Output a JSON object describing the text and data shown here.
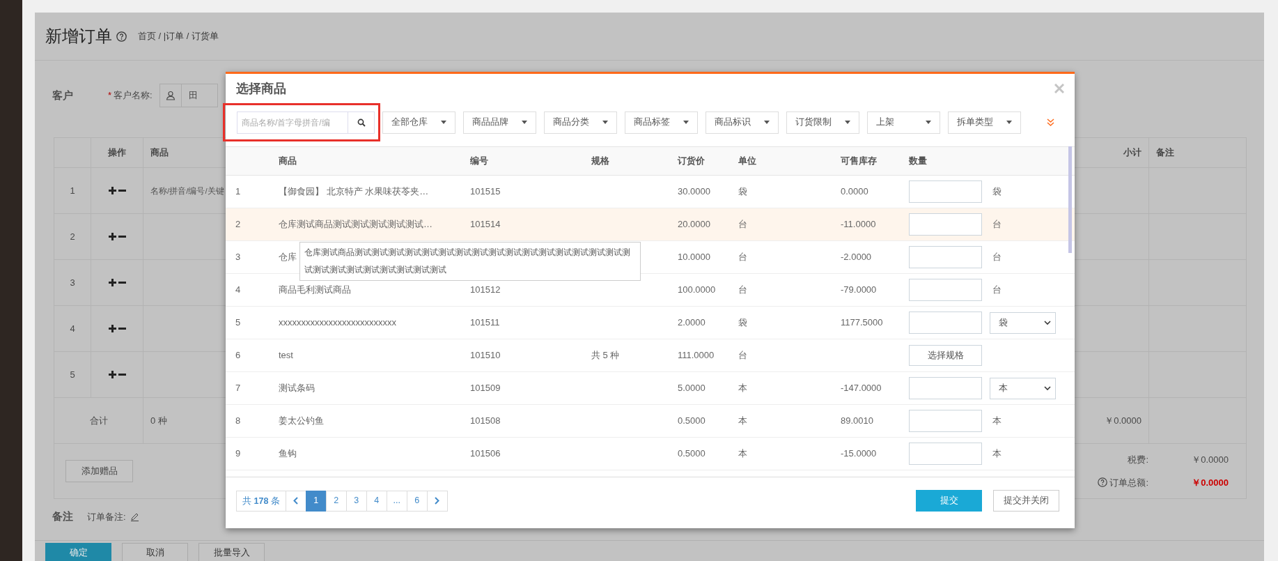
{
  "page": {
    "title": "新增订单",
    "breadcrumb": "首页 / |订单 / 订货单"
  },
  "customer": {
    "section": "客户",
    "required_mark": "*",
    "label": "客户名称:",
    "value": "田"
  },
  "order_table": {
    "columns": [
      "操作",
      "商品",
      "小计",
      "备注"
    ],
    "rows": [
      {
        "index": "1",
        "placeholder": "名称/拼音/编号/关键"
      },
      {
        "index": "2"
      },
      {
        "index": "3"
      },
      {
        "index": "4"
      },
      {
        "index": "5"
      }
    ],
    "total": {
      "label": "合计",
      "count": "0 种",
      "subtotal": "￥0.0000"
    },
    "gift_button": "添加赠品",
    "tax_label": "税费:",
    "tax": "￥0.0000",
    "grand_total_label": "订单总额:",
    "grand_total": "￥0.0000"
  },
  "remarks": {
    "section": "备注",
    "label": "订单备注:"
  },
  "actions": [
    {
      "label": "确定",
      "primary": true
    },
    {
      "label": "取消",
      "primary": false
    },
    {
      "label": "批量导入",
      "primary": false
    }
  ],
  "modal": {
    "title": "选择商品",
    "search": {
      "placeholder": "商品名称/首字母拼音/编",
      "highlighted": true
    },
    "filters": [
      "全部仓库",
      "商品品牌",
      "商品分类",
      "商品标签",
      "商品标识",
      "订货限制",
      "上架",
      "拆单类型"
    ],
    "columns": [
      "商品",
      "编号",
      "规格",
      "订货价",
      "单位",
      "可售库存",
      "数量"
    ],
    "rows": [
      {
        "index": "1",
        "name": "【御食园】 北京特产 水果味茯苓夹…",
        "code": "101515",
        "price": "30.0000",
        "unit": "袋",
        "stock": "0.0000",
        "kind": "input",
        "unit_label": "袋",
        "hovered": false
      },
      {
        "index": "2",
        "name": "仓库测试商品测试测试测试测试测试…",
        "code": "101514",
        "price": "20.0000",
        "unit": "台",
        "stock": "-11.0000",
        "kind": "input",
        "unit_label": "台",
        "hovered": true
      },
      {
        "index": "3",
        "name": "仓库",
        "price": "10.0000",
        "unit": "台",
        "stock": "-2.0000",
        "kind": "input",
        "unit_label": "台",
        "hovered": false
      },
      {
        "index": "4",
        "name": "商品毛利测试商品",
        "code": "101512",
        "price": "100.0000",
        "unit": "台",
        "stock": "-79.0000",
        "kind": "input",
        "unit_label": "台",
        "hovered": false
      },
      {
        "index": "5",
        "name": "xxxxxxxxxxxxxxxxxxxxxxxxxx",
        "code": "101511",
        "price": "2.0000",
        "unit": "袋",
        "stock": "1177.5000",
        "kind": "select",
        "unit_label": "袋",
        "hovered": false
      },
      {
        "index": "6",
        "name": "test",
        "code": "101510",
        "spec": "共 5 种",
        "price": "111.0000",
        "unit": "台",
        "kind": "spec-button",
        "button": "选择规格",
        "hovered": false
      },
      {
        "index": "7",
        "name": "测试条码",
        "code": "101509",
        "price": "5.0000",
        "unit": "本",
        "stock": "-147.0000",
        "kind": "select",
        "unit_label": "本",
        "hovered": false
      },
      {
        "index": "8",
        "name": "姜太公钓鱼",
        "code": "101508",
        "price": "0.5000",
        "unit": "本",
        "stock": "89.0010",
        "kind": "input",
        "unit_label": "本",
        "hovered": false
      },
      {
        "index": "9",
        "name": "鱼钩",
        "code": "101506",
        "price": "0.5000",
        "unit": "本",
        "stock": "-15.0000",
        "kind": "input",
        "unit_label": "本",
        "hovered": false
      }
    ],
    "tooltip": "仓库测试商品测试测试测试测试测试测试测试测试测试测试测试测试测试测试测试测试测试测试测试测试测试测试测试测试测试",
    "pagination": {
      "summary": "共 **178** 条",
      "pages": [
        {
          "label": "1",
          "selected": true
        },
        {
          "label": "2",
          "selected": false
        },
        {
          "label": "3",
          "selected": false
        },
        {
          "label": "4",
          "selected": false
        },
        {
          "label": "...",
          "selected": false
        },
        {
          "label": "6",
          "selected": false
        }
      ]
    },
    "buttons": [
      {
        "label": "提交",
        "primary": true
      },
      {
        "label": "提交并关闭",
        "primary": false
      }
    ]
  }
}
